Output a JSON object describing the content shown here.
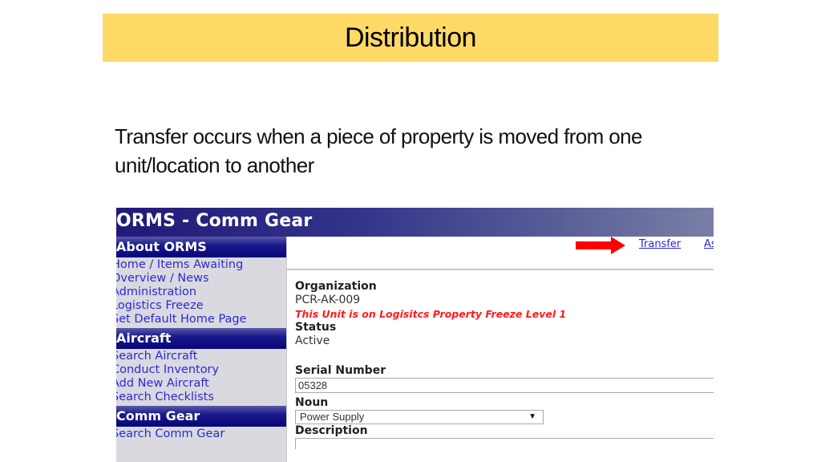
{
  "slide": {
    "title": "Distribution",
    "subtitle": "Transfer occurs when a piece of property is moved from one unit/location to another",
    "colors": {
      "title_band": "#ffd966",
      "arrow": "#ff0000"
    }
  },
  "app": {
    "header_title": "ORMS - Comm Gear",
    "sidebar": {
      "groups": [
        {
          "heading": "About ORMS",
          "links": [
            "Home / Items Awaiting",
            "Overview / News",
            "Administration",
            "Logistics Freeze",
            "Set Default Home Page"
          ]
        },
        {
          "heading": "Aircraft",
          "links": [
            "Search Aircraft",
            "Conduct Inventory",
            "Add New Aircraft",
            "Search Checklists"
          ]
        },
        {
          "heading": "Comm Gear",
          "links": [
            "Search Comm Gear"
          ]
        }
      ]
    },
    "toolbar": {
      "transfer_link": "Transfer",
      "next_link": "As",
      "arrow_icon": "red-arrow-right"
    },
    "form": {
      "organization_label": "Organization",
      "organization_value": "PCR-AK-009",
      "freeze_warning": "This Unit is on Logisitcs Property Freeze Level 1",
      "status_label": "Status",
      "status_value": "Active",
      "serial_label": "Serial Number",
      "serial_value": "05328",
      "noun_label": "Noun",
      "noun_value": "Power Supply",
      "description_label": "Description",
      "description_value": ""
    }
  }
}
